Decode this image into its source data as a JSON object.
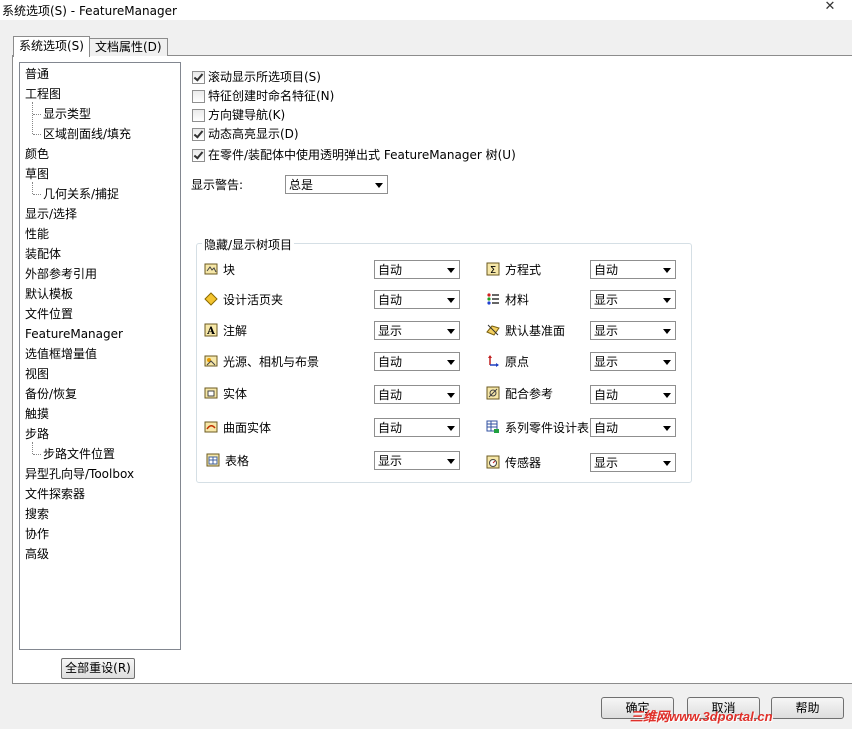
{
  "window": {
    "title": "系统选项(S) - FeatureManager",
    "close": "✕"
  },
  "tabs": [
    {
      "label": "系统选项(S)"
    },
    {
      "label": "文档属性(D)"
    }
  ],
  "tree": {
    "items": [
      {
        "label": "普通"
      },
      {
        "label": "工程图"
      },
      {
        "label": "显示类型"
      },
      {
        "label": "区域剖面线/填充"
      },
      {
        "label": "颜色"
      },
      {
        "label": "草图"
      },
      {
        "label": "几何关系/捕捉"
      },
      {
        "label": "显示/选择"
      },
      {
        "label": "性能"
      },
      {
        "label": "装配体"
      },
      {
        "label": "外部参考引用"
      },
      {
        "label": "默认模板"
      },
      {
        "label": "文件位置"
      },
      {
        "label": "FeatureManager"
      },
      {
        "label": "选值框增量值"
      },
      {
        "label": "视图"
      },
      {
        "label": "备份/恢复"
      },
      {
        "label": "触摸"
      },
      {
        "label": "步路"
      },
      {
        "label": "步路文件位置"
      },
      {
        "label": "异型孔向导/Toolbox"
      },
      {
        "label": "文件探索器"
      },
      {
        "label": "搜索"
      },
      {
        "label": "协作"
      },
      {
        "label": "高级"
      }
    ],
    "reset_label": "全部重设(R)"
  },
  "options": [
    {
      "label": "滚动显示所选项目(S)",
      "checked": true
    },
    {
      "label": "特征创建时命名特征(N)",
      "checked": false
    },
    {
      "label": "方向键导航(K)",
      "checked": false
    },
    {
      "label": "动态高亮显示(D)",
      "checked": true
    },
    {
      "label": "在零件/装配体中使用透明弹出式 FeatureManager 树(U)",
      "checked": true
    }
  ],
  "warning": {
    "label": "显示警告:",
    "value": "总是"
  },
  "hide_show": {
    "title": "隐藏/显示树项目",
    "items": [
      {
        "label": "块",
        "value": "自动",
        "icon": "block-icon"
      },
      {
        "label": "设计活页夹",
        "value": "自动",
        "icon": "design-binder-icon"
      },
      {
        "label": "注解",
        "value": "显示",
        "icon": "annotation-icon"
      },
      {
        "label": "光源、相机与布景",
        "value": "自动",
        "icon": "lights-cameras-icon"
      },
      {
        "label": "实体",
        "value": "自动",
        "icon": "solid-body-icon"
      },
      {
        "label": "曲面实体",
        "value": "自动",
        "icon": "surface-body-icon"
      },
      {
        "label": "表格",
        "value": "显示",
        "icon": "table-icon"
      },
      {
        "label": "方程式",
        "value": "自动",
        "icon": "equation-icon"
      },
      {
        "label": "材料",
        "value": "显示",
        "icon": "material-icon"
      },
      {
        "label": "默认基准面",
        "value": "显示",
        "icon": "plane-icon"
      },
      {
        "label": "原点",
        "value": "显示",
        "icon": "origin-icon"
      },
      {
        "label": "配合参考",
        "value": "自动",
        "icon": "mate-reference-icon"
      },
      {
        "label": "系列零件设计表",
        "value": "自动",
        "icon": "design-table-icon"
      },
      {
        "label": "传感器",
        "value": "显示",
        "icon": "sensor-icon"
      }
    ]
  },
  "buttons": {
    "ok": "确定",
    "cancel": "取消",
    "help": "帮助"
  },
  "watermark": "三维网www.3dportal.cn"
}
